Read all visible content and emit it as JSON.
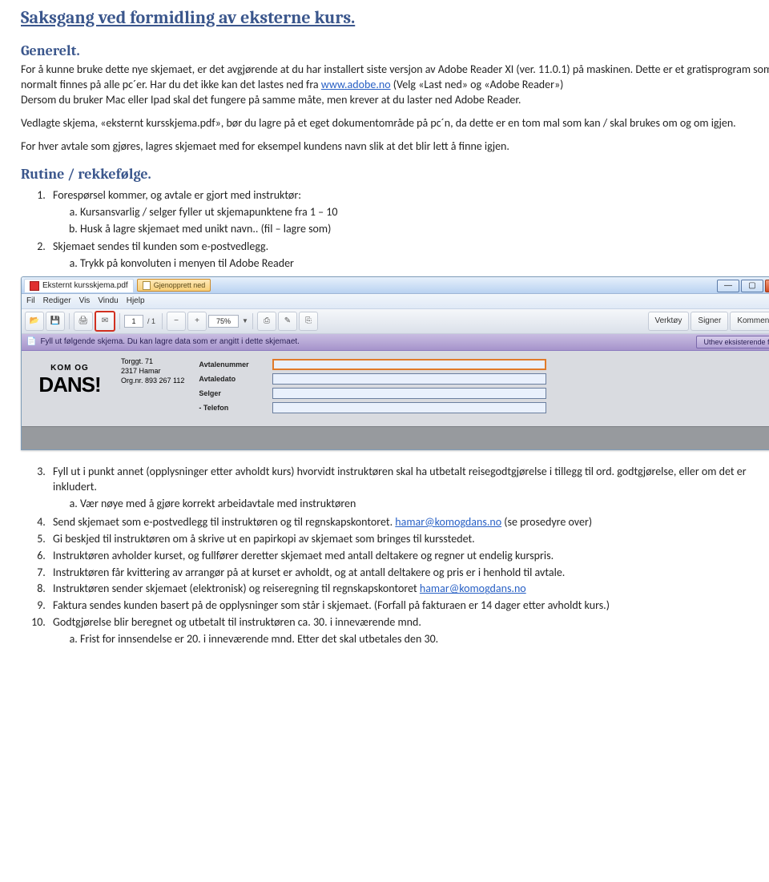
{
  "h1": "Saksgang ved formidling av eksterne kurs.",
  "h2_generelt": "Generelt.",
  "p1a": "For å kunne bruke dette nye skjemaet, er det avgjørende at du har installert siste versjon av Adobe Reader XI (ver. 11.0.1) på maskinen. Dette er et gratisprogram som normalt finnes på alle pc´er. Har du det ikke kan det lastes ned fra ",
  "p1_link": "www.adobe.no",
  "p1b": " (Velg «Last ned» og «Adobe Reader»)",
  "p1c": "Dersom du bruker Mac eller Ipad skal det fungere på samme måte, men krever at du laster ned Adobe Reader.",
  "p2": "Vedlagte skjema, «eksternt kursskjema.pdf», bør du lagre på et eget dokumentområde på pc´n, da dette er en tom mal som kan / skal brukes om og om igjen.",
  "p3": "For hver avtale som gjøres, lagres skjemaet med for eksempel kundens navn slik at det blir lett å finne igjen.",
  "h2_rutine": "Rutine / rekkefølge.",
  "ol1_1": "Forespørsel kommer, og avtale er gjort med instruktør:",
  "ol1_1a": "Kursansvarlig / selger fyller ut skjemapunktene fra 1 – 10",
  "ol1_1b": "Husk å lagre skjemaet med unikt navn.. (fil – lagre som)",
  "ol1_2": "Skjemaet sendes til kunden som e-postvedlegg.",
  "ol1_2a": "Trykk på konvoluten i menyen til Adobe Reader",
  "app": {
    "tabfile": "Eksternt kursskjema.pdf",
    "open": "Gjenopprett ned",
    "menus": [
      "Fil",
      "Rediger",
      "Vis",
      "Vindu",
      "Hjelp"
    ],
    "page_current": "1",
    "page_total": "/ 1",
    "zoom": "75%",
    "right": {
      "verktoy": "Verktøy",
      "signer": "Signer",
      "kommentar": "Kommentar"
    },
    "purple_left": "Fyll ut følgende skjema. Du kan lagre data som er angitt i dette skjemaet.",
    "purple_btn": "Uthev eksisterende felt",
    "logo_top": "KOM OG",
    "logo_main": "DANS!",
    "addr": [
      "Torggt. 71",
      "2317 Hamar",
      "Org.nr. 893 267 112"
    ],
    "labels": [
      "Avtalenummer",
      "Avtaledato",
      "Selger",
      "- Telefon"
    ]
  },
  "ol2_3": "Fyll ut i punkt annet (opplysninger etter avholdt kurs) hvorvidt instruktøren skal ha utbetalt reisegodtgjørelse i tillegg til ord. godtgjørelse, eller om det er inkludert.",
  "ol2_3a": "Vær nøye med å gjøre korrekt arbeidavtale med instruktøren",
  "ol2_4a": "Send skjemaet som e-postvedlegg til instruktøren og til regnskapskontoret.  ",
  "ol2_4_link": "hamar@komogdans.no",
  "ol2_4b": " (se prosedyre over)",
  "ol2_5": "Gi beskjed til instruktøren om å skrive ut en papirkopi av skjemaet som bringes til kursstedet.",
  "ol2_6": "Instruktøren avholder kurset, og fullfører deretter skjemaet med antall deltakere og regner ut endelig kurspris.",
  "ol2_7": "Instruktøren får kvittering av arrangør på at kurset er avholdt, og at antall deltakere og pris er i henhold til avtale.",
  "ol2_8a": "Instruktøren sender skjemaet (elektronisk) og reiseregning til regnskapskontoret ",
  "ol2_8_link": "hamar@komogdans.no",
  "ol2_9": "Faktura sendes kunden basert på de opplysninger som står i skjemaet.  (Forfall på fakturaen er 14 dager etter avholdt kurs.)",
  "ol2_10": "Godtgjørelse blir beregnet og utbetalt til instruktøren ca. 30. i inneværende mnd.",
  "ol2_10a": "Frist for innsendelse er 20. i inneværende mnd. Etter det skal utbetales den 30."
}
